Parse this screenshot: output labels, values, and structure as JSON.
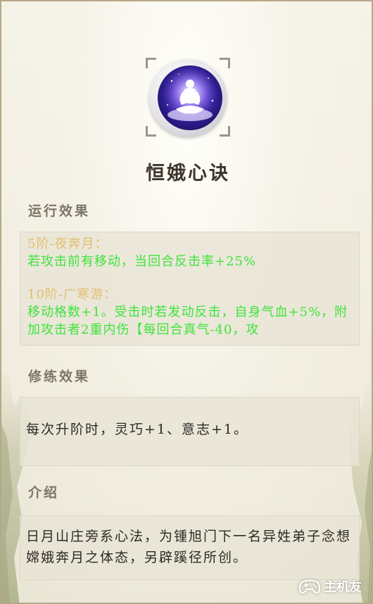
{
  "skill": {
    "title": "恒娥心诀",
    "icon": "meditating-figure-icon"
  },
  "sections": {
    "running_effects": {
      "header": "运行效果",
      "items": [
        {
          "title": "5阶-夜奔月：",
          "desc": "若攻击前有移动，当回合反击率+25%"
        },
        {
          "title": "10阶-广寒游：",
          "desc": "移动格数+1。受击时若发动反击，自身气血+5%，附加攻击者2重内伤【每回合真气-40，攻"
        }
      ]
    },
    "cultivation_effects": {
      "header": "修练效果",
      "text": "每次升阶时，灵巧+1、意志+1。"
    },
    "intro": {
      "header": "介绍",
      "text": "日月山庄旁系心法，为锺旭门下一名异姓弟子念想嫦娥奔月之体态，另辟蹊径所创。"
    }
  },
  "watermark": {
    "label": "主机友",
    "icon": "gamepad-icon"
  },
  "colors": {
    "effect_title": "#e2bf70",
    "effect_desc": "#3fe33c",
    "text_dark": "#2e2a25",
    "header": "#7c7468"
  }
}
